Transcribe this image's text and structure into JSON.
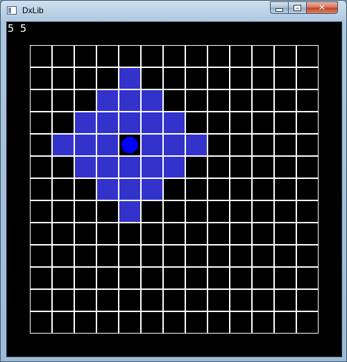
{
  "window": {
    "title": "DxLib",
    "minimize_symbol": "",
    "maximize_symbol": "",
    "close_symbol": "✕"
  },
  "status": {
    "coords": "5 5"
  },
  "board": {
    "rows": 13,
    "cols": 13,
    "player": {
      "row": 4,
      "col": 4
    },
    "reachable_range": 3,
    "colors": {
      "cell": "#000000",
      "grid_line": "#ffffff",
      "reachable": "#3333cc",
      "player": "#0000ff"
    }
  }
}
